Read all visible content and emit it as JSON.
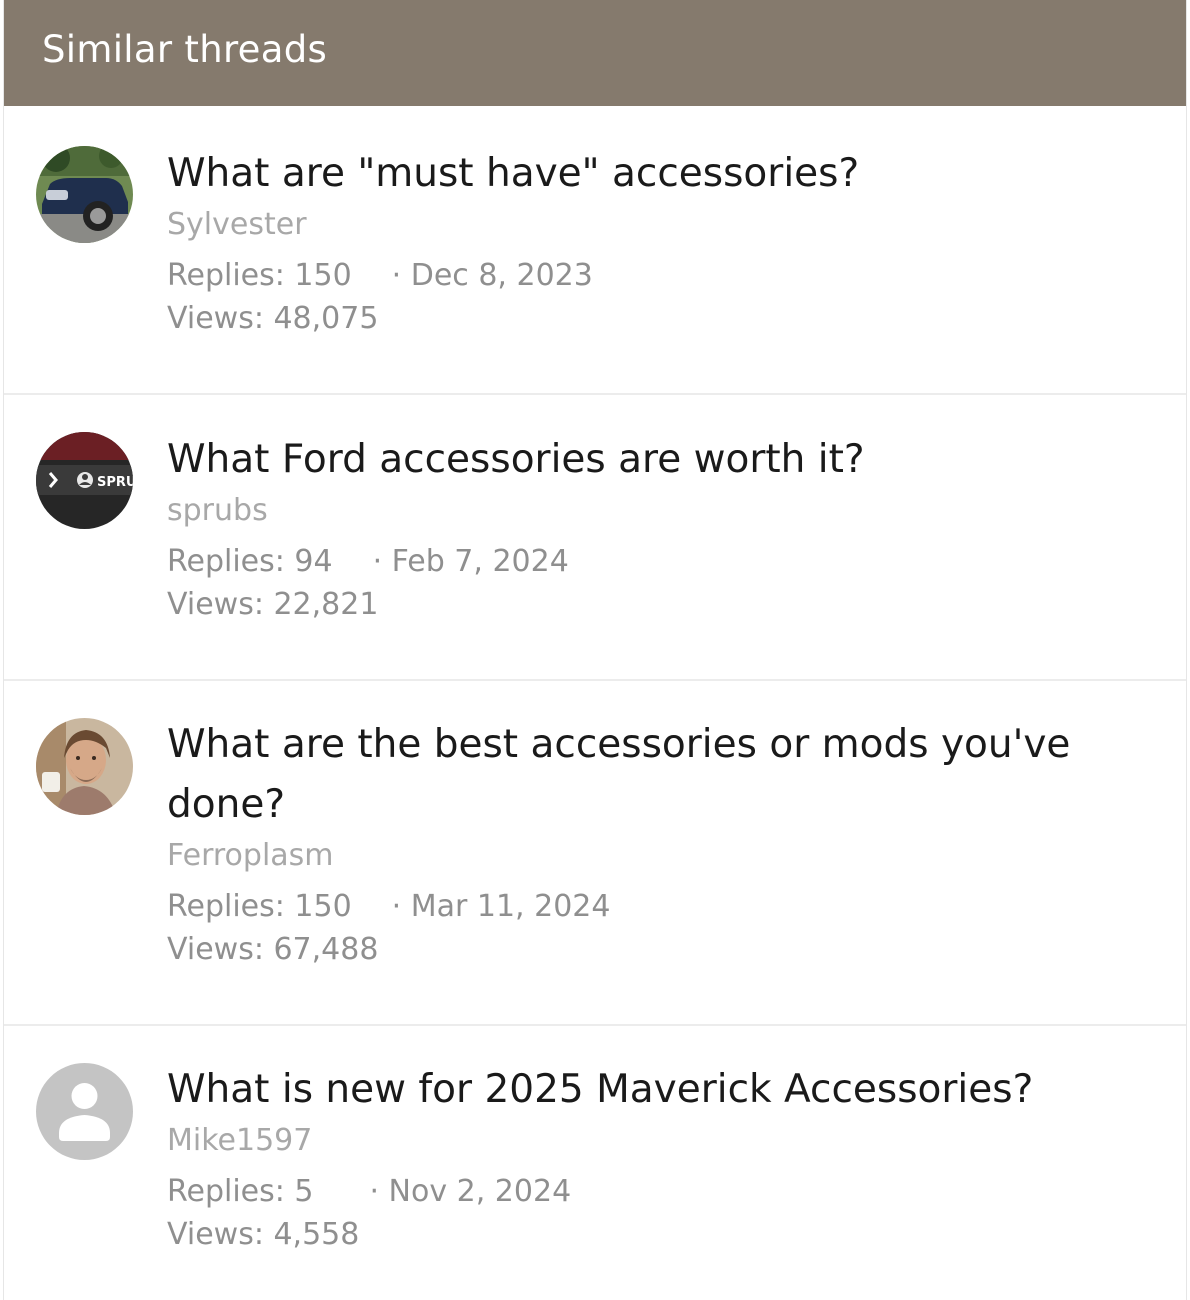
{
  "header": {
    "title": "Similar threads"
  },
  "threads": [
    {
      "title": "What are \"must have\" accessories?",
      "author": "Sylvester",
      "replies": "Replies: 150",
      "date": "· Dec 8, 2023",
      "views": "Views: 48,075",
      "avatar": "car-photo"
    },
    {
      "title": "What Ford accessories are worth it?",
      "author": "sprubs",
      "replies": "Replies: 94",
      "date": "· Feb 7, 2024",
      "views": "Views: 22,821",
      "avatar": "sprubs-logo",
      "avatar_text": "SPRU"
    },
    {
      "title": "What are the best accessories or mods you've done?",
      "author": "Ferroplasm",
      "replies": "Replies: 150",
      "date": "· Mar 11, 2024",
      "views": "Views: 67,488",
      "avatar": "person-photo"
    },
    {
      "title": "What is new for 2025 Maverick Accessories?",
      "author": "Mike1597",
      "replies": "Replies: 5",
      "date": "· Nov 2, 2024",
      "views": "Views: 4,558",
      "avatar": "default-user-icon"
    }
  ],
  "colors": {
    "header_bg": "#857a6d",
    "title_text": "#1a1a1a",
    "author_text": "#a8a8a8",
    "meta_text": "#8f8f8f"
  }
}
